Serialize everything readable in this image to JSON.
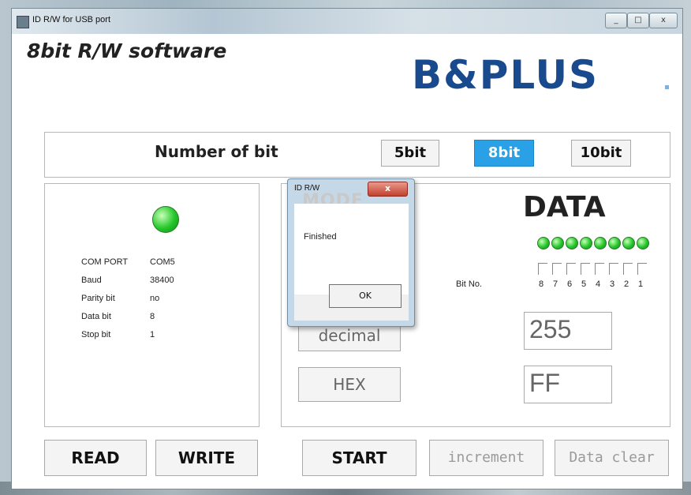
{
  "window": {
    "title": "ID R/W for USB port",
    "controls": [
      "_",
      "□",
      "x"
    ]
  },
  "header": {
    "app_title": "8bit R/W software",
    "logo": "B&PLUS"
  },
  "bits": {
    "label": "Number of bit",
    "options": [
      "5bit",
      "8bit",
      "10bit"
    ],
    "selected": "8bit"
  },
  "com": {
    "port_label": "COM PORT",
    "port": "COM5",
    "baud_label": "Baud",
    "baud": "38400",
    "parity_label": "Parity bit",
    "parity": "no",
    "data_label": "Data bit",
    "data": "8",
    "stop_label": "Stop bit",
    "stop": "1",
    "status_led": "on"
  },
  "mode": {
    "decimal_label": "decimal",
    "hex_label": "HEX"
  },
  "data_panel": {
    "heading": "DATA",
    "bitno_label": "Bit No.",
    "bit_numbers": [
      "8",
      "7",
      "6",
      "5",
      "4",
      "3",
      "2",
      "1"
    ],
    "bit_leds": [
      "on",
      "on",
      "on",
      "on",
      "on",
      "on",
      "on",
      "on"
    ],
    "decimal_value": "255",
    "hex_value": "FF"
  },
  "buttons": {
    "read": "READ",
    "write": "WRITE",
    "start": "START",
    "increment": "increment",
    "data_clear": "Data clear"
  },
  "dialog": {
    "title": "ID R/W",
    "close": "x",
    "message": "Finished",
    "ok": "OK",
    "hidden_text": "MODE"
  },
  "colors": {
    "accent": "#2aa0e6",
    "led_green": "#24c72a",
    "logo_blue": "#1a4a8e"
  }
}
